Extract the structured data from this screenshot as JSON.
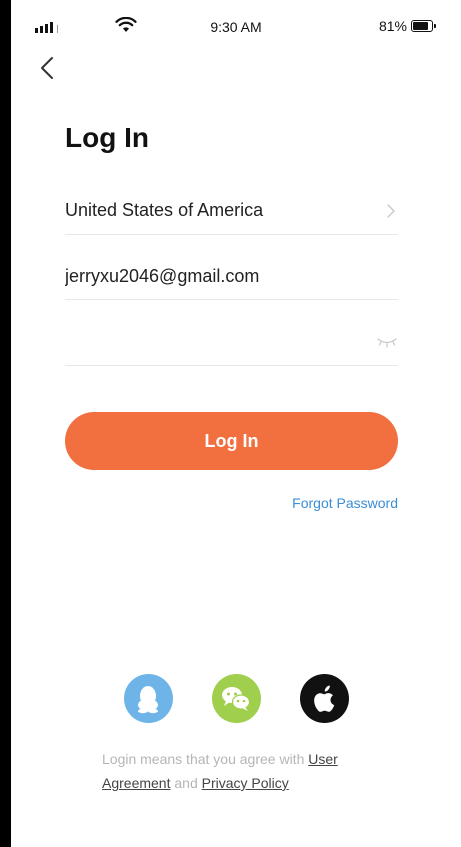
{
  "status_bar": {
    "time": "9:30 AM",
    "battery_percent": "81%",
    "battery_level": 0.81
  },
  "page": {
    "title": "Log In"
  },
  "form": {
    "country_label": "United States of America",
    "email_value": "jerryxu2046@gmail.com",
    "password_value": "",
    "login_button_label": "Log In",
    "forgot_password_label": "Forgot Password"
  },
  "social": {
    "items": [
      {
        "icon": "qq-penguin-icon",
        "color": "#6fb4e8"
      },
      {
        "icon": "wechat-icon",
        "color": "#a0cf4d"
      },
      {
        "icon": "apple-icon",
        "color": "#111111"
      }
    ]
  },
  "agreement": {
    "prefix": "Login means that you agree with ",
    "user_agreement": "User Agreement",
    "conjunction": " and ",
    "privacy_policy": "Privacy Policy"
  },
  "colors": {
    "accent": "#f26f3f",
    "link": "#3a8ed4"
  }
}
